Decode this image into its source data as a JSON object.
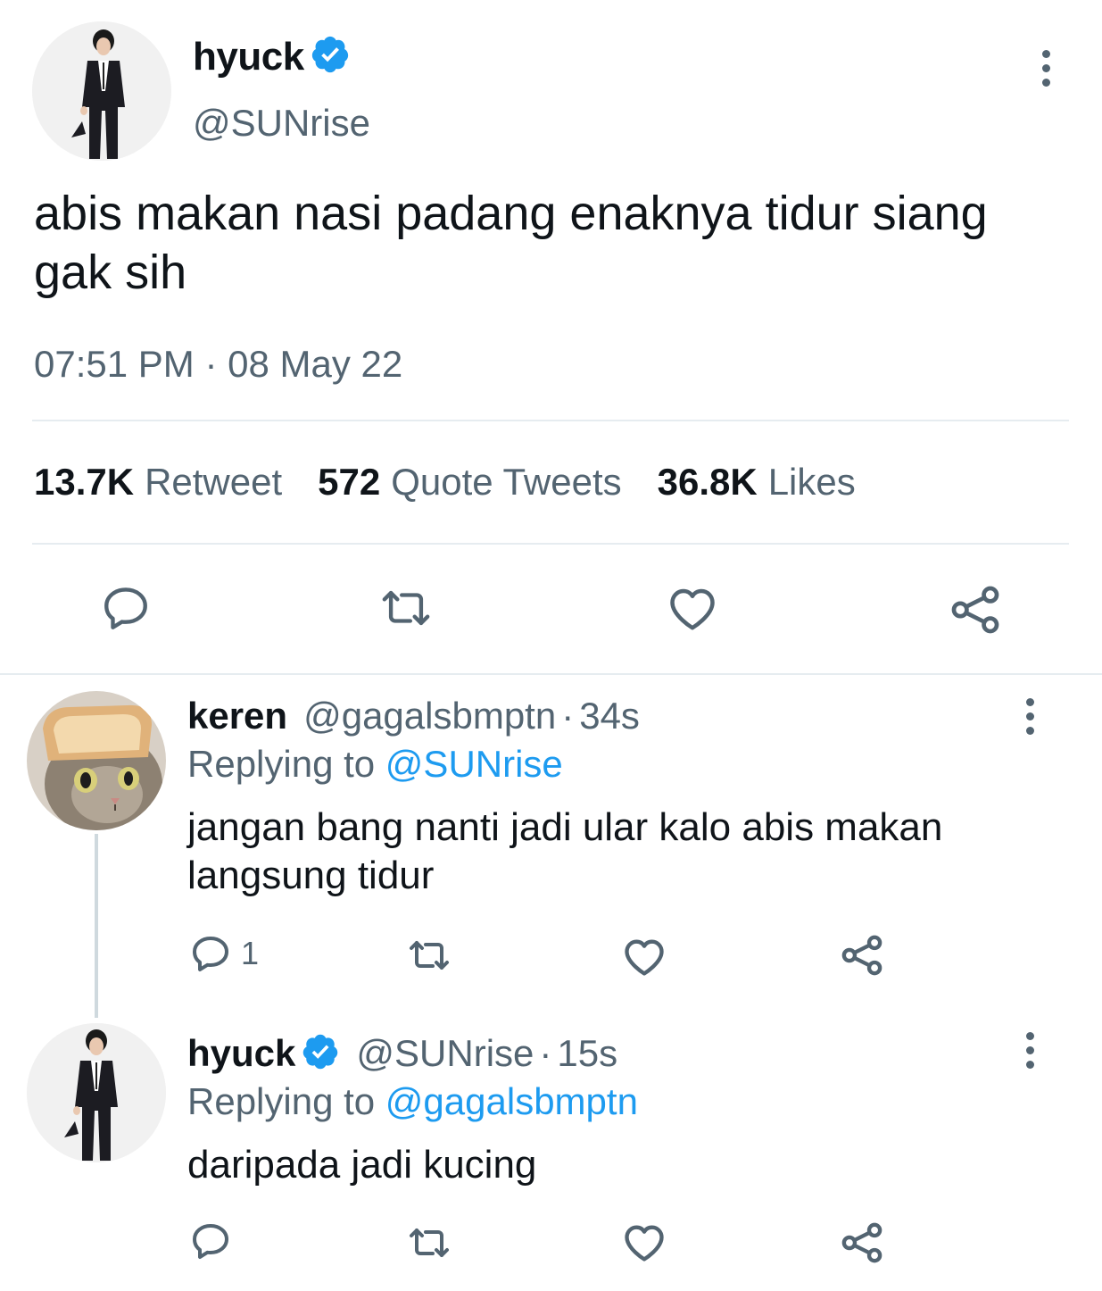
{
  "main_tweet": {
    "author_name": "hyuck",
    "author_handle": "@SUNrise",
    "text": "abis makan nasi padang enaknya tidur siang gak sih",
    "timestamp": "07:51 PM · 08 May 22",
    "stats": [
      {
        "number": "13.7K",
        "label": "Retweet"
      },
      {
        "number": "572",
        "label": "Quote Tweets"
      },
      {
        "number": "36.8K",
        "label": "Likes"
      }
    ],
    "actions": [
      "reply-icon",
      "retweet-icon",
      "heart-icon",
      "share-icon"
    ]
  },
  "replies": [
    {
      "author_name": "keren",
      "author_handle": "@gagalsbmptn",
      "separator": "·",
      "time": "34s",
      "replying_prefix": "Replying to",
      "replying_to": "@SUNrise",
      "text": "jangan bang nanti jadi ular kalo abis makan langsung tidur",
      "reply_count": "1",
      "avatar": "cat-with-bread-avatar"
    },
    {
      "author_name": "hyuck",
      "author_handle": "@SUNrise",
      "separator": "·",
      "time": "15s",
      "replying_prefix": "Replying to",
      "replying_to": "@gagalsbmptn",
      "text": "daripada jadi kucing",
      "reply_count": "",
      "avatar": "person-in-suit-avatar"
    }
  ],
  "colors": {
    "text": "#0f1419",
    "secondary": "#536471",
    "link": "#1d9bf0",
    "divider": "#e6ecf0"
  }
}
